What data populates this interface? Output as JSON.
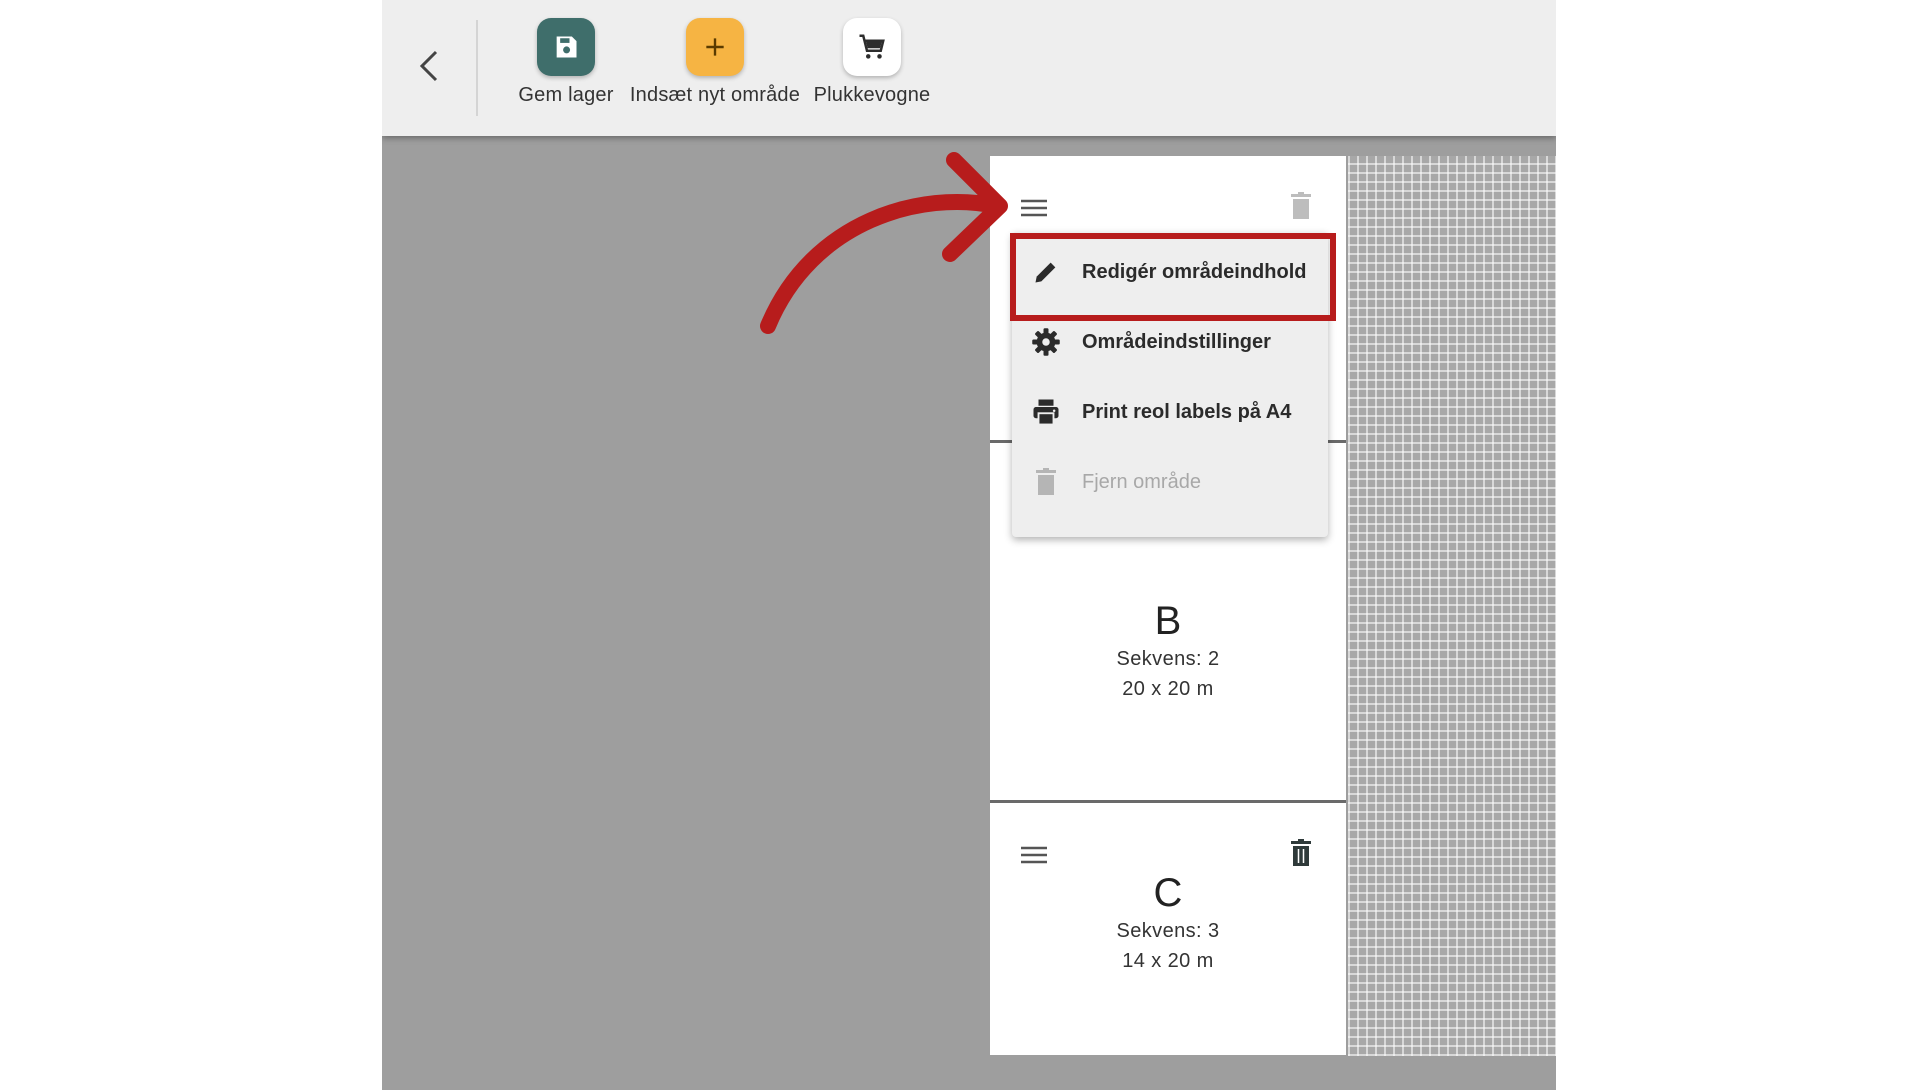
{
  "toolbar": {
    "buttons": [
      {
        "label": "Gem lager",
        "icon": "save-icon",
        "color": "#3f6e6b"
      },
      {
        "label": "Indsæt nyt område",
        "icon": "plus-icon",
        "color": "#f6b443"
      },
      {
        "label": "Plukkevogne",
        "icon": "cart-icon",
        "color": "#ffffff"
      }
    ]
  },
  "area_menu": {
    "items": [
      {
        "label": "Redigér områdeindhold",
        "icon": "pencil-icon",
        "enabled": true,
        "highlighted": true
      },
      {
        "label": "Områdeindstillinger",
        "icon": "gear-icon",
        "enabled": true
      },
      {
        "label": "Print reol labels på A4",
        "icon": "printer-icon",
        "enabled": true
      },
      {
        "label": "Fjern område",
        "icon": "trash-icon",
        "enabled": false
      }
    ]
  },
  "areas": [
    {
      "letter": "B",
      "sequence": "Sekvens: 2",
      "size": "20 x 20 m"
    },
    {
      "letter": "C",
      "sequence": "Sekvens: 3",
      "size": "14 x 20 m"
    }
  ],
  "colors": {
    "annotation": "#b71c1c",
    "canvas": "#9e9e9e",
    "toolbar": "#eeeeee"
  }
}
